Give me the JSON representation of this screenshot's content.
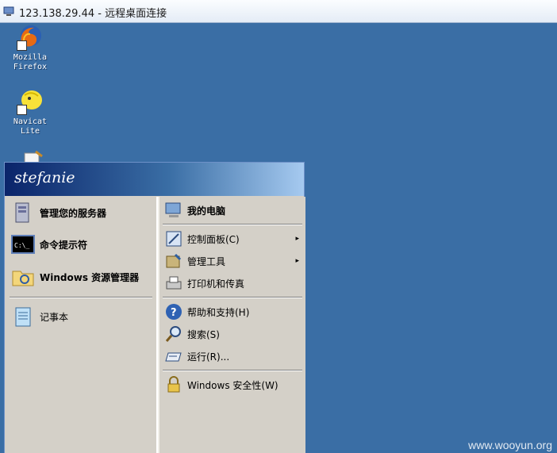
{
  "window": {
    "title": "123.138.29.44 - 远程桌面连接"
  },
  "desktop": {
    "icons": [
      {
        "label_line1": "Mozilla",
        "label_line2": "Firefox",
        "icon": "firefox-icon"
      },
      {
        "label_line1": "Navicat",
        "label_line2": "Lite",
        "icon": "navicat-icon"
      }
    ]
  },
  "start_menu": {
    "user": "stefanie",
    "left_items": [
      {
        "label": "管理您的服务器",
        "icon": "server-manage-icon"
      },
      {
        "label": "命令提示符",
        "icon": "cmd-icon"
      },
      {
        "label": "Windows 资源管理器",
        "icon": "explorer-icon"
      },
      {
        "label": "记事本",
        "icon": "notepad-icon"
      }
    ],
    "right_items": [
      {
        "label": "我的电脑",
        "icon": "my-computer-icon"
      },
      {
        "label": "控制面板(C)",
        "icon": "control-panel-icon",
        "submenu": true
      },
      {
        "label": "管理工具",
        "icon": "admin-tools-icon",
        "submenu": true
      },
      {
        "label": "打印机和传真",
        "icon": "printer-icon"
      },
      {
        "label": "帮助和支持(H)",
        "icon": "help-icon"
      },
      {
        "label": "搜索(S)",
        "icon": "search-icon"
      },
      {
        "label": "运行(R)...",
        "icon": "run-icon"
      },
      {
        "label": "Windows 安全性(W)",
        "icon": "security-lock-icon"
      }
    ],
    "submenu_arrow": "▸"
  },
  "watermark": "www.wooyun.org",
  "colors": {
    "desktop": "#3a6ea5",
    "menu_bg": "#d4d0c8",
    "header_dark": "#0a246a"
  }
}
